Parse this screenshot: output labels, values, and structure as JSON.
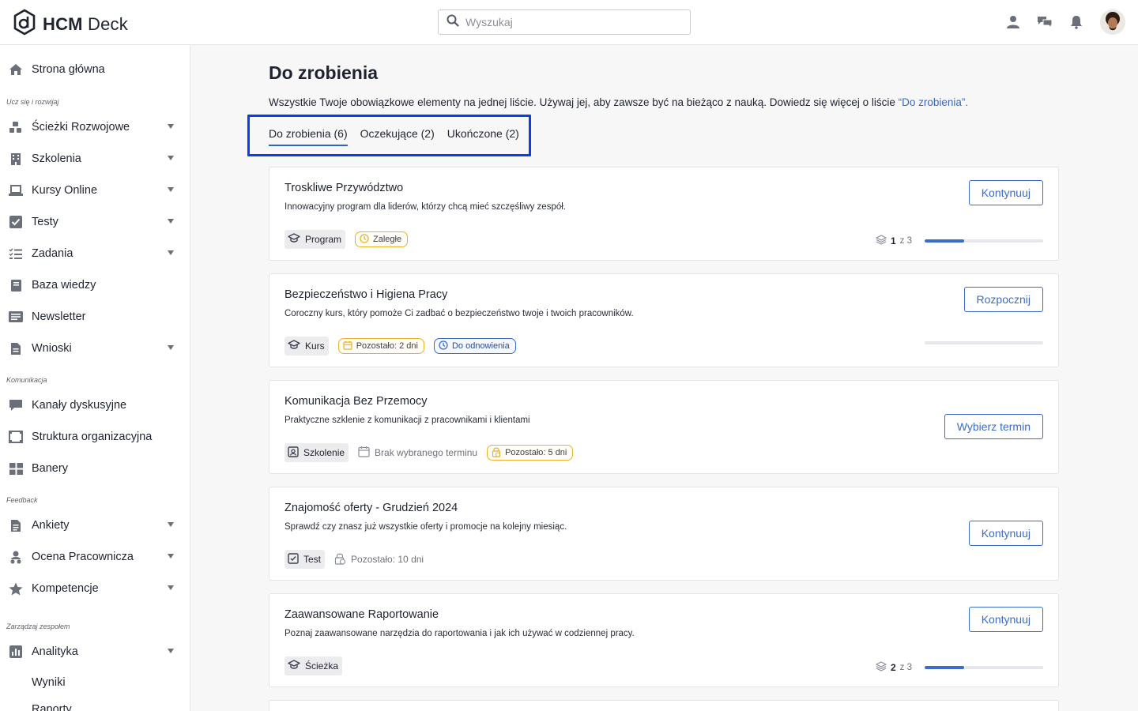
{
  "app": {
    "logo_strong": "HCM",
    "logo_light": " Deck"
  },
  "search": {
    "placeholder": "Wyszukaj"
  },
  "sidebar": {
    "items": [
      {
        "label": "Strona główna",
        "icon": "home-icon",
        "caret": false
      },
      {
        "label": "Ścieżki Rozwojowe",
        "icon": "path-icon",
        "caret": true
      },
      {
        "label": "Szkolenia",
        "icon": "building-icon",
        "caret": true
      },
      {
        "label": "Kursy Online",
        "icon": "laptop-icon",
        "caret": true
      },
      {
        "label": "Testy",
        "icon": "checkbox-icon",
        "caret": true
      },
      {
        "label": "Zadania",
        "icon": "tasks-icon",
        "caret": true
      },
      {
        "label": "Baza wiedzy",
        "icon": "book-icon",
        "caret": false
      },
      {
        "label": "Newsletter",
        "icon": "newsletter-icon",
        "caret": false
      },
      {
        "label": "Wnioski",
        "icon": "document-icon",
        "caret": true
      },
      {
        "label": "Kanały dyskusyjne",
        "icon": "chat-icon",
        "caret": false
      },
      {
        "label": "Struktura organizacyjna",
        "icon": "org-chart-icon",
        "caret": false
      },
      {
        "label": "Banery",
        "icon": "grid-icon",
        "caret": false
      },
      {
        "label": "Ankiety",
        "icon": "survey-icon",
        "caret": true
      },
      {
        "label": "Ocena Pracownicza",
        "icon": "people-icon",
        "caret": true
      },
      {
        "label": "Kompetencje",
        "icon": "star-icon",
        "caret": true
      },
      {
        "label": "Analityka",
        "icon": "chart-icon",
        "caret": true
      },
      {
        "label": "Wyniki",
        "icon": "",
        "caret": false
      },
      {
        "label": "Raporty",
        "icon": "",
        "caret": false
      }
    ],
    "sections": [
      "Ucz się i rozwijaj",
      "Komunikacja",
      "Feedback",
      "Zarządzaj zespołem"
    ]
  },
  "main": {
    "title": "Do zrobienia",
    "description": "Wszystkie Twoje obowiązkowe elementy na jednej liście. Używaj jej, aby zawsze być na bieżąco z nauką. Dowiedz się więcej o liście ",
    "description_link": "“Do zrobienia”.",
    "tabs": [
      {
        "label": "Do zrobienia (6)",
        "active": true
      },
      {
        "label": "Oczekujące (2)",
        "active": false
      },
      {
        "label": "Ukończone (2)",
        "active": false
      }
    ]
  },
  "cards": [
    {
      "title": "Troskliwe Przywództwo",
      "description": "Innowacyjny program dla liderów, którzy chcą mieć szczęśliwy zespół.",
      "button": "Kontynuuj",
      "type": "Program",
      "type_icon": "graduation-cap-icon",
      "pills": [
        {
          "label": "Zaległe",
          "style": "yellow",
          "icon": "clock-icon"
        }
      ],
      "meta": "",
      "progress": {
        "current": "1",
        "of_text": "z 3",
        "fraction": 0.33
      }
    },
    {
      "title": "Bezpieczeństwo i Higiena Pracy",
      "description": "Coroczny kurs, który pomoże Ci zadbać o bezpieczeństwo twoje i twoich pracowników.",
      "button": "Rozpocznij",
      "type": "Kurs",
      "type_icon": "graduation-cap-icon",
      "pills": [
        {
          "label": "Pozostało: 2 dni",
          "style": "yellow",
          "icon": "calendar-icon"
        },
        {
          "label": "Do odnowienia",
          "style": "blue",
          "icon": "clock-icon"
        }
      ],
      "meta": "",
      "progress": {
        "current": "",
        "of_text": "",
        "fraction": 0
      }
    },
    {
      "title": "Komunikacja Bez Przemocy",
      "description": "Praktyczne szklenie z komunikacji z pracownikami i klientami",
      "button": "Wybierz termin",
      "type": "Szkolenie",
      "type_icon": "training-icon",
      "pills": [
        {
          "label": "Pozostało: 5 dni",
          "style": "yellow",
          "icon": "lock-clock-icon"
        }
      ],
      "meta": "Brak wybranego terminu",
      "progress": null
    },
    {
      "title": "Znajomość oferty - Grudzień 2024",
      "description": "Sprawdź czy znasz już wszystkie oferty i promocje na kolejny miesiąc.",
      "button": "Kontynuuj",
      "type": "Test",
      "type_icon": "checkbox-icon",
      "pills": [],
      "meta": "Pozostało: 10 dni",
      "progress": null
    },
    {
      "title": "Zaawansowane Raportowanie",
      "description": "Poznaj zaawansowane narzędzia do raportowania i jak ich używać w codziennej pracy.",
      "button": "Kontynuuj",
      "type": "Ścieżka",
      "type_icon": "graduation-cap-icon",
      "pills": [],
      "meta": "",
      "progress": {
        "current": "2",
        "of_text": "z 3",
        "fraction": 0.33
      }
    }
  ],
  "colors": {
    "accent": "#3a6cc9",
    "highlight": "#0a3ee8",
    "warning": "#e8b32a"
  }
}
